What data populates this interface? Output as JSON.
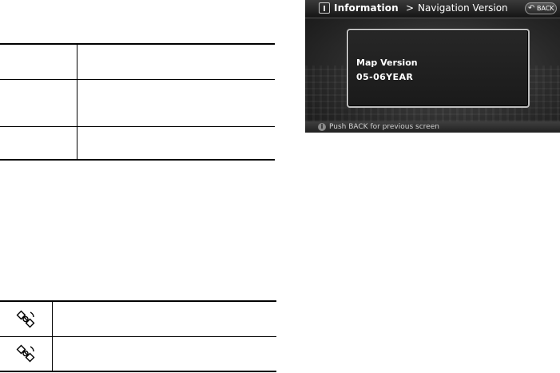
{
  "screen": {
    "title": "Information",
    "separator": ">",
    "subtitle": "Navigation Version",
    "back_label": "BACK",
    "icons": {
      "title": "info-box-icon",
      "back": "back-arrow-icon",
      "status": "info-circle-icon"
    },
    "panel": {
      "label": "Map Version",
      "value": "05-06YEAR"
    },
    "status_text": "Push BACK for previous screen",
    "status_icon_glyph": "i",
    "back_icon_glyph": "↶"
  },
  "left_tables": {
    "table1_rows": 3,
    "table2_icons": [
      "satellite-icon",
      "satellite-icon"
    ]
  }
}
